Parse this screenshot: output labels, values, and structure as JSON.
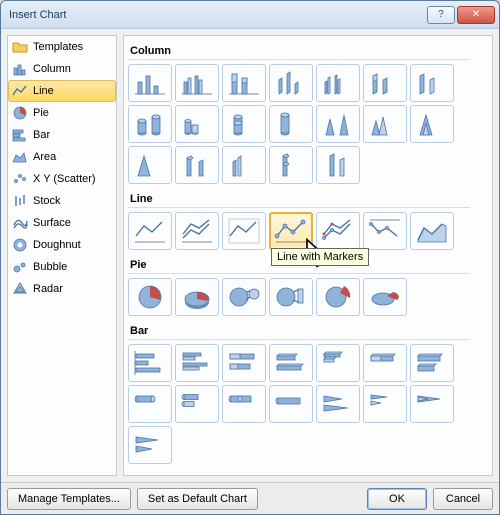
{
  "titlebar": {
    "title": "Insert Chart"
  },
  "sidebar": {
    "items": [
      {
        "label": "Templates"
      },
      {
        "label": "Column"
      },
      {
        "label": "Line"
      },
      {
        "label": "Pie"
      },
      {
        "label": "Bar"
      },
      {
        "label": "Area"
      },
      {
        "label": "X Y (Scatter)"
      },
      {
        "label": "Stock"
      },
      {
        "label": "Surface"
      },
      {
        "label": "Doughnut"
      },
      {
        "label": "Bubble"
      },
      {
        "label": "Radar"
      }
    ],
    "selected_index": 2
  },
  "gallery": {
    "sections": [
      {
        "label": "Column",
        "count": 19
      },
      {
        "label": "Line",
        "count": 7
      },
      {
        "label": "Pie",
        "count": 6
      },
      {
        "label": "Bar",
        "count": 15
      }
    ],
    "hovered": {
      "section": "Line",
      "index": 3,
      "tooltip": "Line with Markers"
    }
  },
  "footer": {
    "manage": "Manage Templates...",
    "setdefault": "Set as Default Chart",
    "ok": "OK",
    "cancel": "Cancel"
  }
}
